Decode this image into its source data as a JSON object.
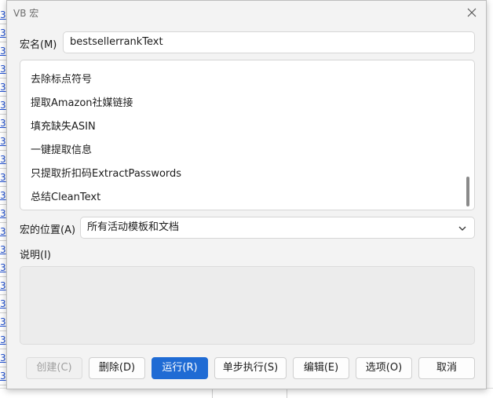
{
  "window": {
    "title": "VB 宏"
  },
  "macro_name": {
    "label": "宏名(M)",
    "value": "bestsellerrankText"
  },
  "macro_list": {
    "items": [
      "去除标点符号",
      "提取Amazon社媒链接",
      "填充缺失ASIN",
      "一键提取信息",
      "只提取折扣码ExtractPasswords",
      "总结CleanText"
    ]
  },
  "location": {
    "label": "宏的位置(A)",
    "value": "所有活动模板和文档"
  },
  "description": {
    "label": "说明(I)"
  },
  "buttons": {
    "create": "创建(C)",
    "delete": "删除(D)",
    "run": "运行(R)",
    "step": "单步执行(S)",
    "edit": "编辑(E)",
    "options": "选项(O)",
    "cancel": "取消"
  },
  "colors": {
    "primary": "#1f6bd4",
    "dialog_bg": "#f3f3f3"
  }
}
